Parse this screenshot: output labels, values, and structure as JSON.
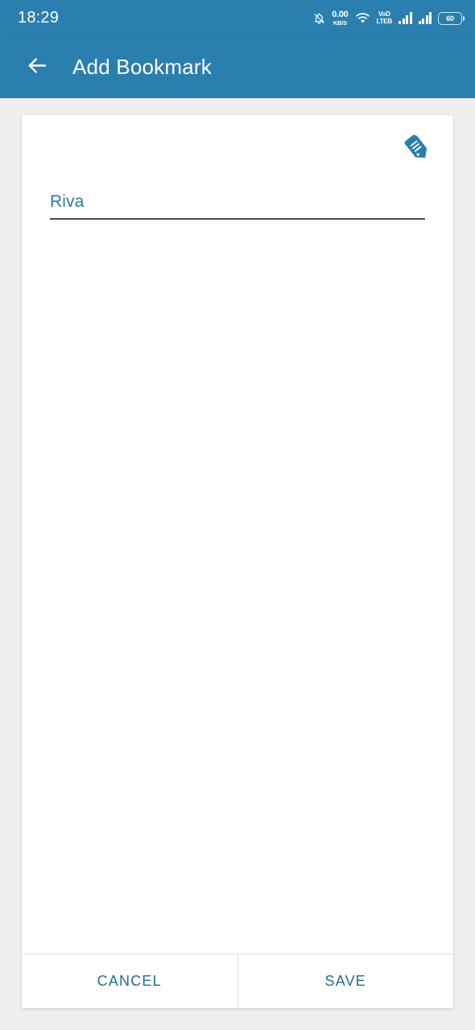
{
  "status_bar": {
    "clock": "18:29",
    "notification_icon": "bell-muted-icon",
    "net_speed_value": "0.00",
    "net_speed_unit": "KB/S",
    "wifi_icon": "wifi-icon",
    "volte_line1": "VoD",
    "volte_line2": "LTEB",
    "signal_icon_1": "signal-bars-icon",
    "signal_icon_2": "signal-bars-icon",
    "battery_level": "60",
    "background_color": "#2a7fae"
  },
  "app_bar": {
    "back_icon": "arrow-left-icon",
    "title": "Add Bookmark",
    "background_color": "#2a7fae",
    "title_color": "#ffffff"
  },
  "card": {
    "edit_icon": "pencil-edit-icon",
    "edit_icon_color": "#2a7fae",
    "name_field": {
      "value": "Riva",
      "placeholder": "",
      "text_color": "#2e7c9e",
      "underline_color": "#4a4a4a"
    },
    "actions": {
      "cancel_label": "CANCEL",
      "save_label": "SAVE",
      "label_color": "#1f6f95"
    }
  },
  "theme": {
    "page_background": "#efefef",
    "card_background": "#ffffff",
    "accent": "#2a7fae"
  }
}
